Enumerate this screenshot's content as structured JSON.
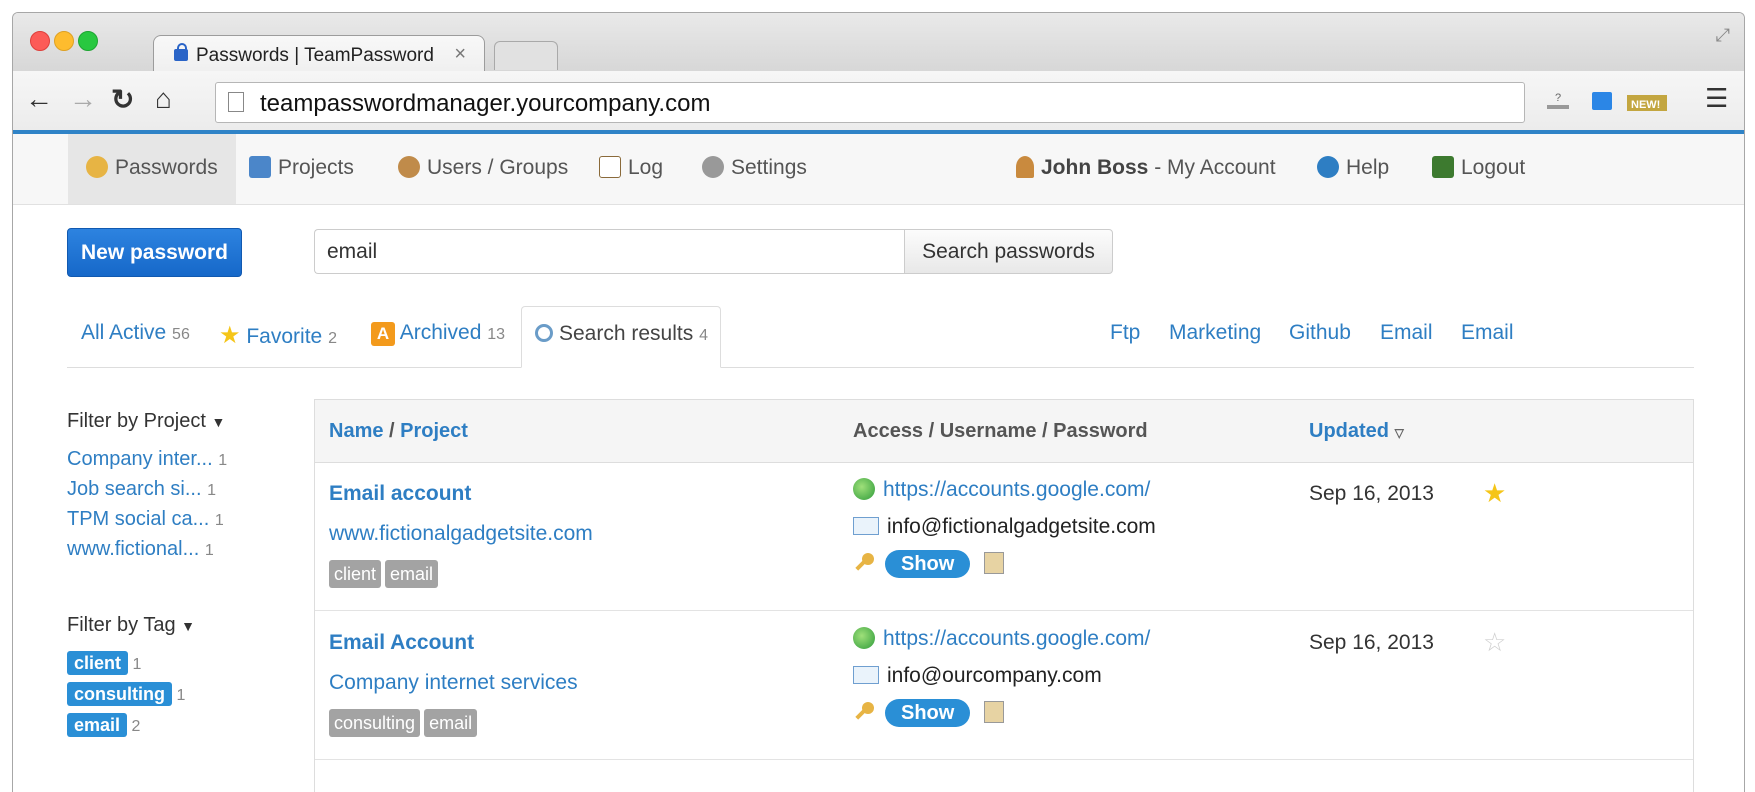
{
  "browser": {
    "tab_title": "Passwords | TeamPassword",
    "tab_close": "×",
    "url": "teampasswordmanager.yourcompany.com"
  },
  "nav": {
    "passwords": "Passwords",
    "projects": "Projects",
    "users_groups": "Users / Groups",
    "log": "Log",
    "settings": "Settings",
    "user_name": "John Boss",
    "my_account": " - My Account",
    "help": "Help",
    "logout": "Logout"
  },
  "toolbar": {
    "new_password": "New password",
    "search_value": "email",
    "search_button": "Search passwords"
  },
  "filters": {
    "all_active": "All Active",
    "all_active_count": "56",
    "favorite": "Favorite",
    "favorite_count": "2",
    "archived_badge": "A",
    "archived": "Archived",
    "archived_count": "13",
    "search_results": "Search results",
    "search_results_count": "4"
  },
  "quick_links": [
    "Ftp",
    "Marketing",
    "Github",
    "Email",
    "Email"
  ],
  "sidebar": {
    "project_title": "Filter by Project",
    "projects": [
      {
        "label": "Company inter...",
        "count": "1"
      },
      {
        "label": "Job search si...",
        "count": "1"
      },
      {
        "label": "TPM social ca...",
        "count": "1"
      },
      {
        "label": "www.fictional...",
        "count": "1"
      }
    ],
    "tag_title": "Filter by Tag",
    "tags": [
      {
        "label": "client",
        "count": "1"
      },
      {
        "label": "consulting",
        "count": "1"
      },
      {
        "label": "email",
        "count": "2"
      }
    ]
  },
  "table": {
    "col_name": "Name",
    "col_sep": " / ",
    "col_project": "Project",
    "col_access": "Access / Username / Password",
    "col_updated": "Updated",
    "rows": [
      {
        "name": "Email account",
        "project": "www.fictionalgadgetsite.com",
        "tags": [
          "client",
          "email"
        ],
        "access": "https://accounts.google.com/",
        "username": "info@fictionalgadgetsite.com",
        "show": "Show",
        "updated": "Sep 16, 2013",
        "favorite": true
      },
      {
        "name": "Email Account",
        "project": "Company internet services",
        "tags": [
          "consulting",
          "email"
        ],
        "access": "https://accounts.google.com/",
        "username": "info@ourcompany.com",
        "show": "Show",
        "updated": "Sep 16, 2013",
        "favorite": false
      }
    ]
  },
  "colors": {
    "accent": "#2e7ec3",
    "button": "#1668c9",
    "star_on": "#f5c518",
    "star_off": "#cfcfcf"
  }
}
